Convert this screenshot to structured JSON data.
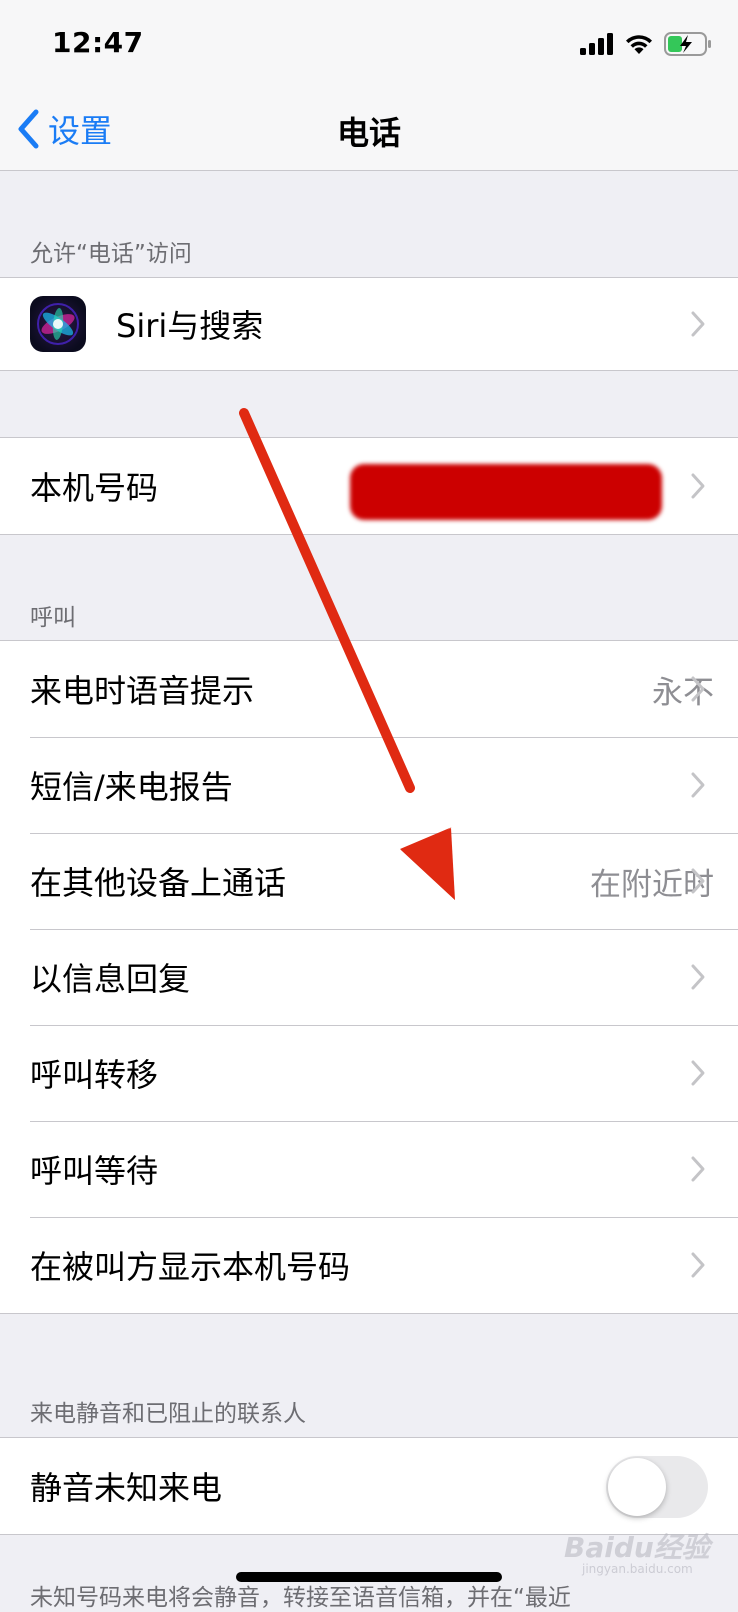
{
  "status_bar": {
    "time": "12:47"
  },
  "nav": {
    "back_label": "设置",
    "title": "电话"
  },
  "sections": {
    "allow_access": {
      "header": "允许“电话”访问",
      "siri_label": "Siri与搜索"
    },
    "my_number": {
      "label": "本机号码"
    },
    "calls": {
      "header": "呼叫",
      "items": [
        {
          "label": "来电时语音提示",
          "value": "永不"
        },
        {
          "label": "短信/来电报告",
          "value": ""
        },
        {
          "label": "在其他设备上通话",
          "value": "在附近时"
        },
        {
          "label": "以信息回复",
          "value": ""
        },
        {
          "label": "呼叫转移",
          "value": ""
        },
        {
          "label": "呼叫等待",
          "value": ""
        },
        {
          "label": "在被叫方显示本机号码",
          "value": ""
        }
      ]
    },
    "silence": {
      "header": "来电静音和已阻止的联系人",
      "silence_unknown_label": "静音未知来电",
      "silence_unknown_on": false,
      "footer": "未知号码来电将会静音，转接至语音信箱，并在“最近"
    }
  },
  "watermark": {
    "text": "Baidu经验",
    "sub": "jingyan.baidu.com"
  },
  "colors": {
    "accent": "#1a7cf5",
    "background": "#efeff4",
    "annotation_arrow": "#e02a12",
    "redaction": "#cc0000"
  }
}
